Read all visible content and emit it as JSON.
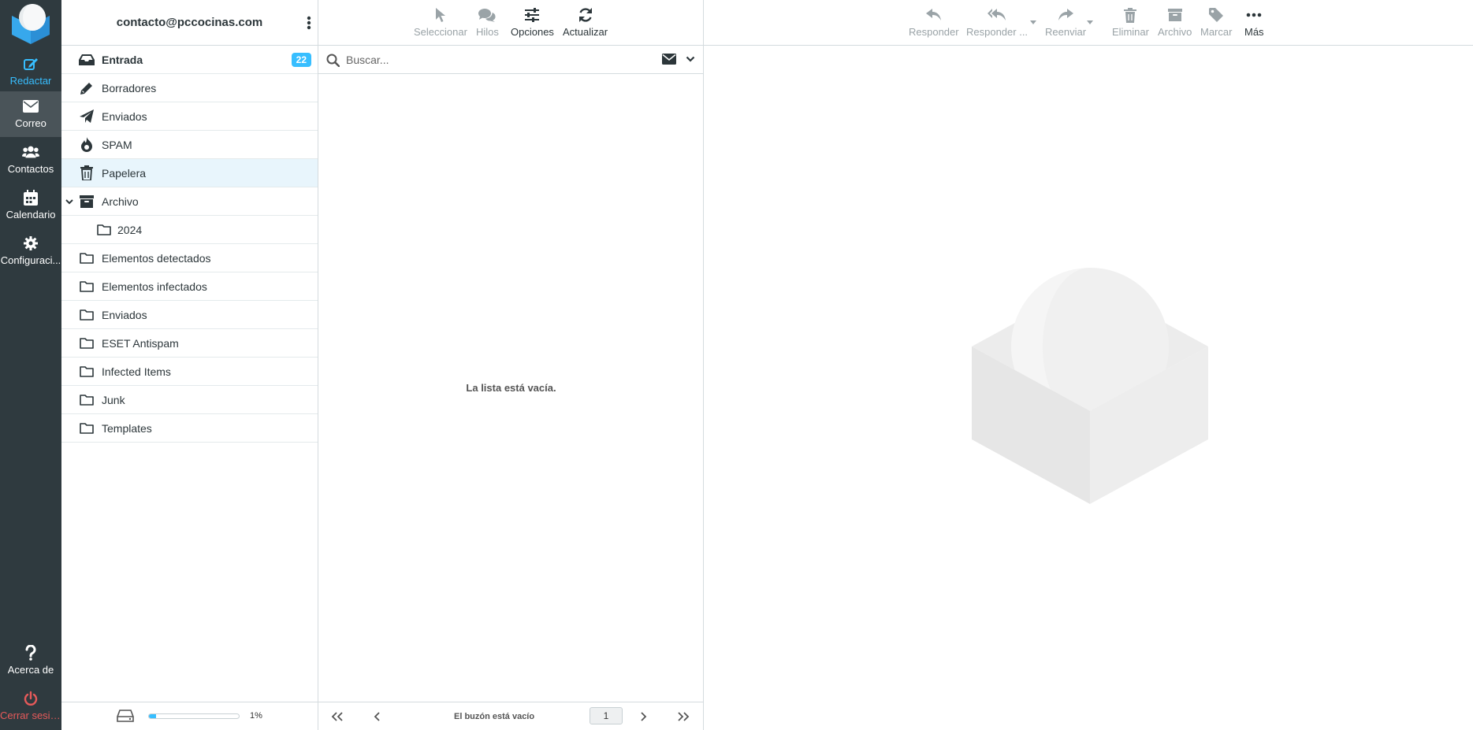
{
  "nav": {
    "compose": "Redactar",
    "mail": "Correo",
    "contacts": "Contactos",
    "calendar": "Calendario",
    "settings": "Configuraci...",
    "about": "Acerca de",
    "logout": "Cerrar sesión"
  },
  "account": {
    "email": "contacto@pccocinas.com"
  },
  "folders": [
    {
      "label": "Entrada",
      "icon": "inbox-icon",
      "unread": "22"
    },
    {
      "label": "Borradores",
      "icon": "pencil-icon"
    },
    {
      "label": "Enviados",
      "icon": "paper-plane-icon"
    },
    {
      "label": "SPAM",
      "icon": "fire-icon"
    },
    {
      "label": "Papelera",
      "icon": "trash-icon"
    },
    {
      "label": "Archivo",
      "icon": "archive-box-icon"
    },
    {
      "label": "2024",
      "icon": "folder-icon"
    },
    {
      "label": "Elementos detectados",
      "icon": "folder-icon"
    },
    {
      "label": "Elementos infectados",
      "icon": "folder-icon"
    },
    {
      "label": "Enviados",
      "icon": "folder-icon"
    },
    {
      "label": "ESET Antispam",
      "icon": "folder-icon"
    },
    {
      "label": "Infected Items",
      "icon": "folder-icon"
    },
    {
      "label": "Junk",
      "icon": "folder-icon"
    },
    {
      "label": "Templates",
      "icon": "folder-icon"
    }
  ],
  "quota": {
    "text": "1%",
    "fraction": 0.01
  },
  "list_toolbar": {
    "select": "Seleccionar",
    "threads": "Hilos",
    "options": "Opciones",
    "refresh": "Actualizar"
  },
  "search": {
    "placeholder": "Buscar..."
  },
  "list": {
    "empty_message": "La lista está vacía.",
    "footer_status": "El buzón está vacío",
    "page": "1"
  },
  "preview_toolbar": {
    "reply": "Responder",
    "reply_all": "Responder ...",
    "forward": "Reenviar",
    "delete": "Eliminar",
    "archive": "Archivo",
    "mark": "Marcar",
    "more": "Más"
  },
  "colors": {
    "accent": "#37beff",
    "nav_bg": "#2f3a3f",
    "nav_active": "#4a5459",
    "logout": "#e75a5a",
    "selected_row": "#e8f5fc"
  }
}
